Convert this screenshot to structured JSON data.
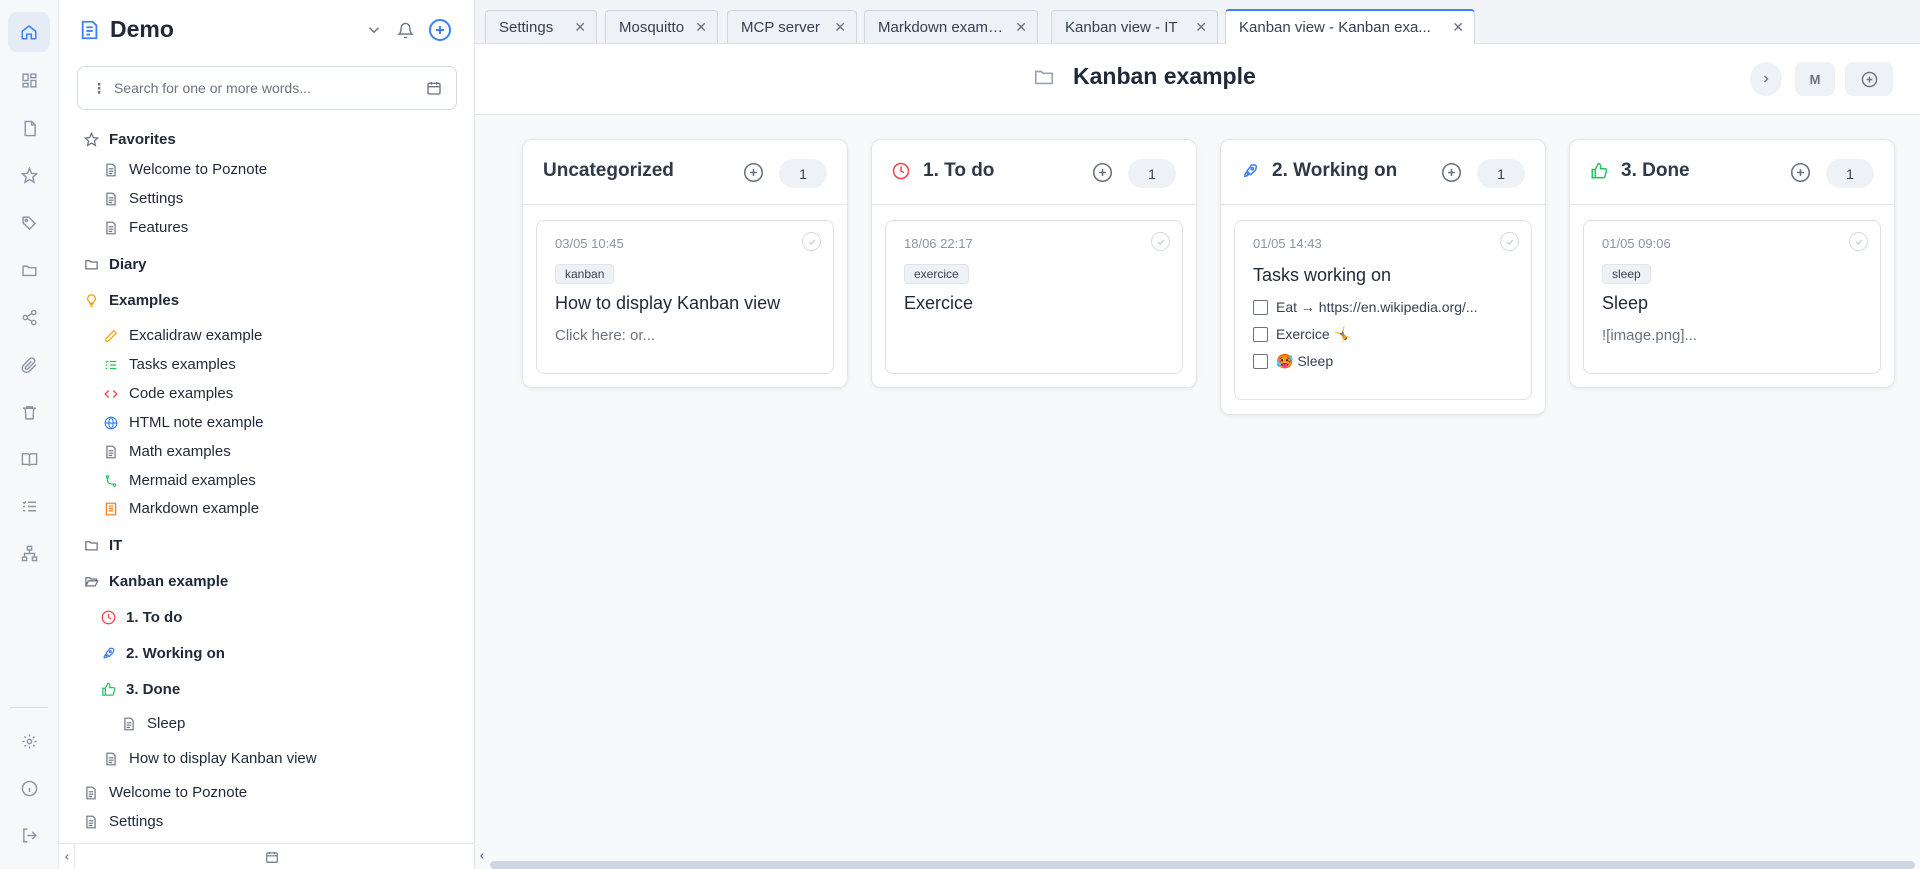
{
  "app": {
    "title": "Demo"
  },
  "search": {
    "placeholder": "Search for one or more words..."
  },
  "sidebar": {
    "items": [
      {
        "label": "Favorites",
        "icon": "star-icon",
        "bold": true
      },
      {
        "label": "Welcome to Poznote",
        "icon": "document-icon"
      },
      {
        "label": "Settings",
        "icon": "document-icon"
      },
      {
        "label": "Features",
        "icon": "document-icon"
      },
      {
        "label": "Diary",
        "icon": "folder-icon",
        "bold": true
      },
      {
        "label": "Examples",
        "icon": "lightbulb-icon",
        "bold": true
      },
      {
        "label": "Excalidraw example",
        "icon": "pencil-icon"
      },
      {
        "label": "Tasks examples",
        "icon": "checklist-icon"
      },
      {
        "label": "Code examples",
        "icon": "code-icon"
      },
      {
        "label": "HTML note example",
        "icon": "globe-icon"
      },
      {
        "label": "Math examples",
        "icon": "document-icon"
      },
      {
        "label": "Mermaid examples",
        "icon": "git-branch-icon"
      },
      {
        "label": "Markdown example",
        "icon": "markdown-icon"
      },
      {
        "label": "IT",
        "icon": "folder-icon",
        "bold": true
      },
      {
        "label": "Kanban example",
        "icon": "folder-open-icon",
        "bold": true
      },
      {
        "label": "1. To do",
        "icon": "clock-icon",
        "bold": true
      },
      {
        "label": "2. Working on",
        "icon": "rocket-icon",
        "bold": true
      },
      {
        "label": "3. Done",
        "icon": "thumbs-up-icon",
        "bold": true
      },
      {
        "label": "Sleep",
        "icon": "document-icon"
      },
      {
        "label": "How to display Kanban view",
        "icon": "document-icon"
      },
      {
        "label": "Welcome to Poznote",
        "icon": "document-icon"
      },
      {
        "label": "Settings",
        "icon": "document-icon"
      }
    ]
  },
  "tabs": [
    {
      "label": "Settings"
    },
    {
      "label": "Mosquitto"
    },
    {
      "label": "MCP server"
    },
    {
      "label": "Markdown example"
    },
    {
      "label": "Kanban view - IT"
    },
    {
      "label": "Kanban view - Kanban exa...",
      "active": true
    }
  ],
  "header": {
    "title": "Kanban example",
    "user_initial": "M"
  },
  "columns": [
    {
      "title": "Uncategorized",
      "icon": "none",
      "count": "1",
      "card": {
        "date": "03/05 10:45",
        "tag": "kanban",
        "title": "How to display Kanban view",
        "snippet": "Click here:             or..."
      }
    },
    {
      "title": "1. To do",
      "icon": "clock-icon",
      "count": "1",
      "card": {
        "date": "18/06 22:17",
        "tag": "exercice",
        "title": "Exercice"
      }
    },
    {
      "title": "2. Working on",
      "icon": "rocket-icon",
      "count": "1",
      "card": {
        "date": "01/05 14:43",
        "title": "Tasks working on",
        "tasks": [
          "Eat → https://en.wikipedia.org/...",
          "Exercice 🤸",
          "🥵 Sleep"
        ]
      }
    },
    {
      "title": "3. Done",
      "icon": "thumbs-up-icon",
      "count": "1",
      "card": {
        "date": "01/05 09:06",
        "tag": "sleep",
        "title": "Sleep",
        "snippet": "![image.png]..."
      }
    }
  ],
  "colors": {
    "accent": "#3b82f6",
    "todo": "#ef4444",
    "working": "#3b82f6",
    "done": "#22c55e",
    "examples": "#f59e0b"
  }
}
